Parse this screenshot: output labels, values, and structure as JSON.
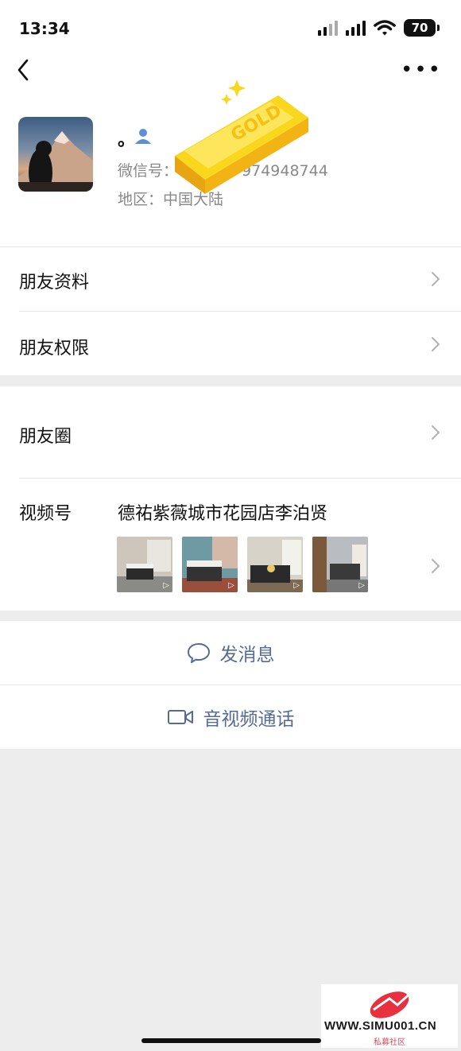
{
  "status_bar": {
    "time": "13:34",
    "battery": "70",
    "icons": [
      "signal-icon",
      "signal-icon",
      "wifi-icon",
      "battery-icon"
    ]
  },
  "nav": {
    "back_icon": "chevron-left-icon",
    "more_label": "•••"
  },
  "profile": {
    "nickname": "。",
    "wechat_id": "微信号：",
    "wechat_id_tail": "974948744",
    "region": "地区：中国大陆"
  },
  "menu": {
    "friend_info": "朋友资料",
    "friend_permissions": "朋友权限",
    "moments": "朋友圈",
    "channels_label": "视频号",
    "channels_name": "德祐紫薇城市花园店李泊贤"
  },
  "actions": {
    "send_message": "发消息",
    "video_call": "音视频通话"
  },
  "watermark": {
    "site": "WWW.SIMU001.CN",
    "sub": "私募社区"
  },
  "sticker": {
    "text": "GOLD"
  },
  "colors": {
    "accent": "#576b95",
    "background": "#ededed",
    "surface": "#ffffff"
  }
}
